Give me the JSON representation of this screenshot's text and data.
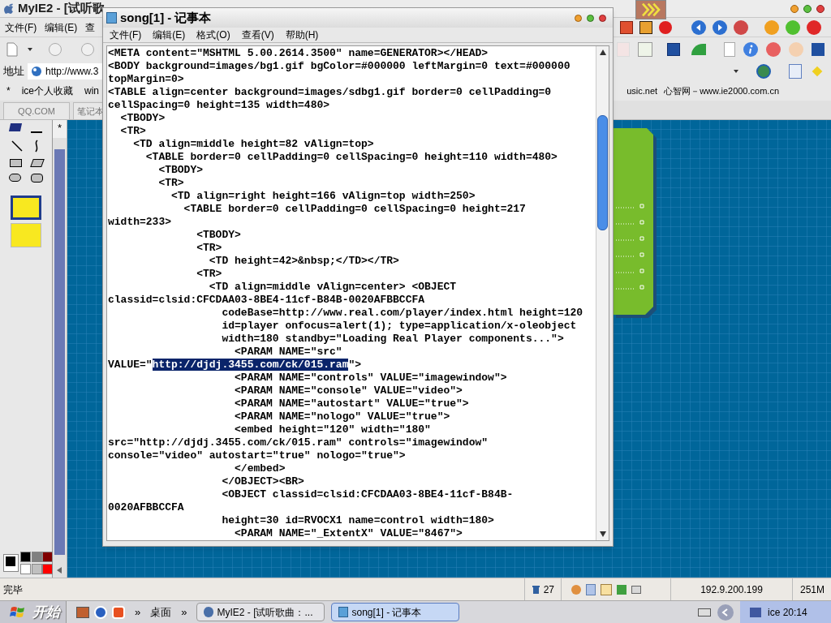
{
  "browser": {
    "title": "MyIE2 - [试听歌",
    "menu": [
      "文件(F)",
      "编辑(E)",
      "查"
    ],
    "address": {
      "label": "地址",
      "value": "http://www.3"
    },
    "links_left": [
      "*",
      "ice个人收藏",
      "win"
    ],
    "links_right": [
      "usic.net",
      "心智网－www.ie2000.com.cn"
    ],
    "tabs": [
      "QQ.COM",
      "笔记本"
    ],
    "side_tab": "*",
    "palette": [
      {
        "color": "#000000"
      },
      {
        "color": "#808080"
      },
      {
        "color": "#800000"
      },
      {
        "color": "#ffffff"
      },
      {
        "color": "#c0c0c0"
      },
      {
        "color": "#ff0000"
      }
    ],
    "status_bar": {
      "text": "完毕",
      "count": "27",
      "ip": "192.9.200.199",
      "memory": "251M"
    }
  },
  "notepad": {
    "title": "song[1] - 记事本",
    "menu": [
      "文件(F)",
      "编辑(E)",
      "格式(O)",
      "查看(V)",
      "帮助(H)"
    ],
    "lines": [
      {
        "text": "<META content=\"MSHTML 5.00.2614.3500\" name=GENERATOR></HEAD>"
      },
      {
        "text": "<BODY background=images/bg1.gif bgColor=#000000 leftMargin=0 text=#000000"
      },
      {
        "text": "topMargin=0>"
      },
      {
        "text": "<TABLE align=center background=images/sdbg1.gif border=0 cellPadding=0"
      },
      {
        "text": "cellSpacing=0 height=135 width=480>"
      },
      {
        "text": "  <TBODY>"
      },
      {
        "text": "  <TR>"
      },
      {
        "text": "    <TD align=middle height=82 vAlign=top>"
      },
      {
        "text": "      <TABLE border=0 cellPadding=0 cellSpacing=0 height=110 width=480>"
      },
      {
        "text": "        <TBODY>"
      },
      {
        "text": "        <TR>"
      },
      {
        "text": "          <TD align=right height=166 vAlign=top width=250>"
      },
      {
        "text": "            <TABLE border=0 cellPadding=0 cellSpacing=0 height=217"
      },
      {
        "text": "width=233>"
      },
      {
        "text": "              <TBODY>"
      },
      {
        "text": "              <TR>"
      },
      {
        "text": "                <TD height=42>&nbsp;</TD></TR>"
      },
      {
        "text": "              <TR>"
      },
      {
        "text": "                <TD align=middle vAlign=center> <OBJECT"
      },
      {
        "text": "classid=clsid:CFCDAA03-8BE4-11cf-B84B-0020AFBBCCFA"
      },
      {
        "text": "                  codeBase=http://www.real.com/player/index.html height=120"
      },
      {
        "text": "                  id=player onfocus=alert(1); type=application/x-oleobject"
      },
      {
        "text": "                  width=180 standby=\"Loading Real Player components...\">"
      },
      {
        "text": "                    <PARAM NAME=\"src\""
      },
      {
        "text": "VALUE=\"",
        "selected_text": "http://djdj.3455.com/ck/015.ram",
        "after": "\">"
      },
      {
        "text": "                    <PARAM NAME=\"controls\" VALUE=\"imagewindow\">"
      },
      {
        "text": "                    <PARAM NAME=\"console\" VALUE=\"video\">"
      },
      {
        "text": "                    <PARAM NAME=\"autostart\" VALUE=\"true\">"
      },
      {
        "text": "                    <PARAM NAME=\"nologo\" VALUE=\"true\">"
      },
      {
        "text": "                    <embed height=\"120\" width=\"180\""
      },
      {
        "text": "src=\"http://djdj.3455.com/ck/015.ram\" controls=\"imagewindow\""
      },
      {
        "text": "console=\"video\" autostart=\"true\" nologo=\"true\">"
      },
      {
        "text": "                    </embed>"
      },
      {
        "text": "                  </OBJECT><BR>"
      },
      {
        "text": "                  <OBJECT classid=clsid:CFCDAA03-8BE4-11cf-B84B-"
      },
      {
        "text": "0020AFBBCCFA"
      },
      {
        "text": "                  height=30 id=RVOCX1 name=control width=180>"
      },
      {
        "text": "                    <PARAM NAME=\"_ExtentX\" VALUE=\"8467\">"
      }
    ]
  },
  "taskbar": {
    "start": "开始",
    "chevron_1": "»",
    "desktop": "桌面",
    "chevron_2": "»",
    "tasks": [
      {
        "label": "MyIE2 - [试听歌曲：...",
        "selected": false
      },
      {
        "label": "song[1] - 记事本",
        "selected": true
      }
    ],
    "clock": "ice 20:14"
  }
}
